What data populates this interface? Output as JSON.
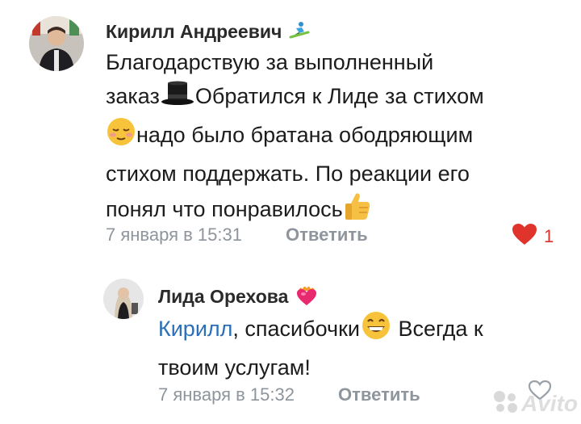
{
  "comment": {
    "author": "Кирилл Андреевич",
    "author_badge": "snowboarder-emoji",
    "lines": [
      "Благодарствую за выполненный",
      "заказ",
      "Обратился к Лиде за стихом",
      "надо было братана ободряющим",
      "стихом поддержать. По реакции его",
      "понял что понравилось"
    ],
    "timestamp": "7 января в 15:31",
    "reply_label": "Ответить",
    "like_count": "1",
    "like_color": "#e0332b"
  },
  "reply": {
    "author": "Лида Орехова",
    "author_badge": "heart-fire-emoji",
    "mention": "Кирилл",
    "text_part1": ", спасибочки",
    "text_part2": " Всегда к",
    "text_line2": "твоим услугам!",
    "timestamp": "7 января в 15:32",
    "reply_label": "Ответить"
  },
  "watermark": {
    "brand": "Avito"
  },
  "colors": {
    "mention": "#2a6fb8",
    "meta": "#8e959c"
  }
}
